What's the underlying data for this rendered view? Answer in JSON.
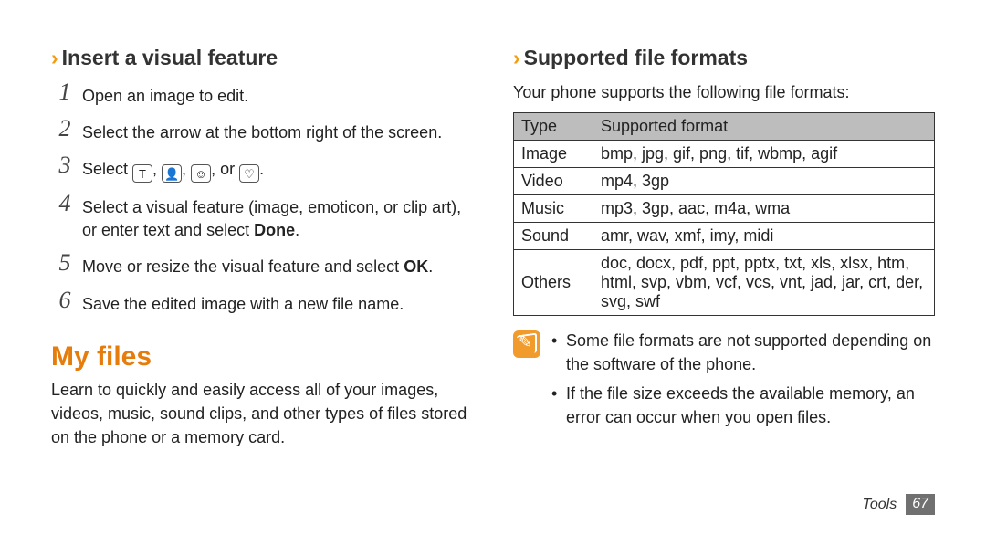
{
  "left": {
    "heading_chevron": "›",
    "heading": "Insert a visual feature",
    "steps": [
      {
        "num": "1",
        "text": "Open an image to edit."
      },
      {
        "num": "2",
        "text": "Select the arrow at the bottom right of the screen."
      },
      {
        "num": "3",
        "prefix": "Select ",
        "icons": [
          "T",
          "👤",
          "☺",
          "♡"
        ],
        "sep": ", ",
        "or_word": "or",
        "suffix": "."
      },
      {
        "num": "4",
        "text_a": "Select a visual feature (image, emoticon, or clip art), or enter text and select ",
        "bold": "Done",
        "text_b": "."
      },
      {
        "num": "5",
        "text_a": "Move or resize the visual feature and select ",
        "bold": "OK",
        "text_b": "."
      },
      {
        "num": "6",
        "text": "Save the edited image with a new file name."
      }
    ],
    "section_title": "My files",
    "section_intro": "Learn to quickly and easily access all of your images, videos, music, sound clips, and other types of files stored on the phone or a memory card."
  },
  "right": {
    "heading_chevron": "›",
    "heading": "Supported file formats",
    "lead": "Your phone supports the following file formats:",
    "table": {
      "head": {
        "type": "Type",
        "format": "Supported format"
      },
      "rows": [
        {
          "type": "Image",
          "format": "bmp, jpg, gif, png, tif, wbmp, agif"
        },
        {
          "type": "Video",
          "format": "mp4, 3gp"
        },
        {
          "type": "Music",
          "format": "mp3, 3gp, aac, m4a, wma"
        },
        {
          "type": "Sound",
          "format": "amr, wav, xmf, imy, midi"
        },
        {
          "type": "Others",
          "format": "doc, docx, pdf, ppt, pptx, txt, xls, xlsx, htm, html, svp, vbm, vcf, vcs, vnt, jad, jar, crt, der, svg, swf"
        }
      ]
    },
    "notes": [
      "Some file formats are not supported depending on the software of the phone.",
      "If the file size exceeds the available memory, an error can occur when you open files."
    ]
  },
  "footer": {
    "section": "Tools",
    "page": "67"
  }
}
